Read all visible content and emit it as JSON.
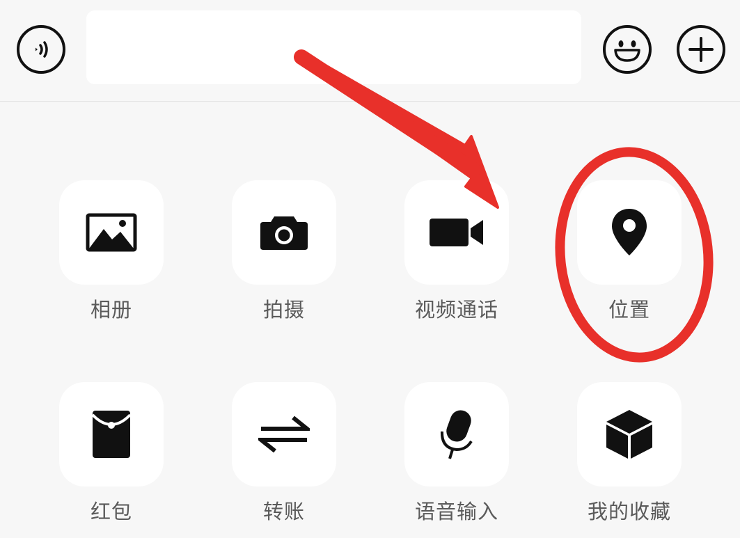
{
  "input_bar": {
    "voice_icon": "voice-wave-icon",
    "emoji_icon": "smiley-face-icon",
    "plus_icon": "plus-icon",
    "message_value": ""
  },
  "panel": {
    "items": [
      {
        "label": "相册",
        "icon": "photo-album-icon"
      },
      {
        "label": "拍摄",
        "icon": "camera-icon"
      },
      {
        "label": "视频通话",
        "icon": "video-call-icon"
      },
      {
        "label": "位置",
        "icon": "location-pin-icon"
      },
      {
        "label": "红包",
        "icon": "red-packet-icon"
      },
      {
        "label": "转账",
        "icon": "transfer-arrows-icon"
      },
      {
        "label": "语音输入",
        "icon": "microphone-icon"
      },
      {
        "label": "我的收藏",
        "icon": "favorites-box-icon"
      }
    ]
  },
  "annotation": {
    "color": "#e8302a",
    "arrow": "red-arrow",
    "circle": "red-circle-highlight"
  },
  "colors": {
    "background": "#f7f7f7",
    "tile": "#ffffff",
    "icon": "#111111",
    "label": "#5a5a5a"
  }
}
